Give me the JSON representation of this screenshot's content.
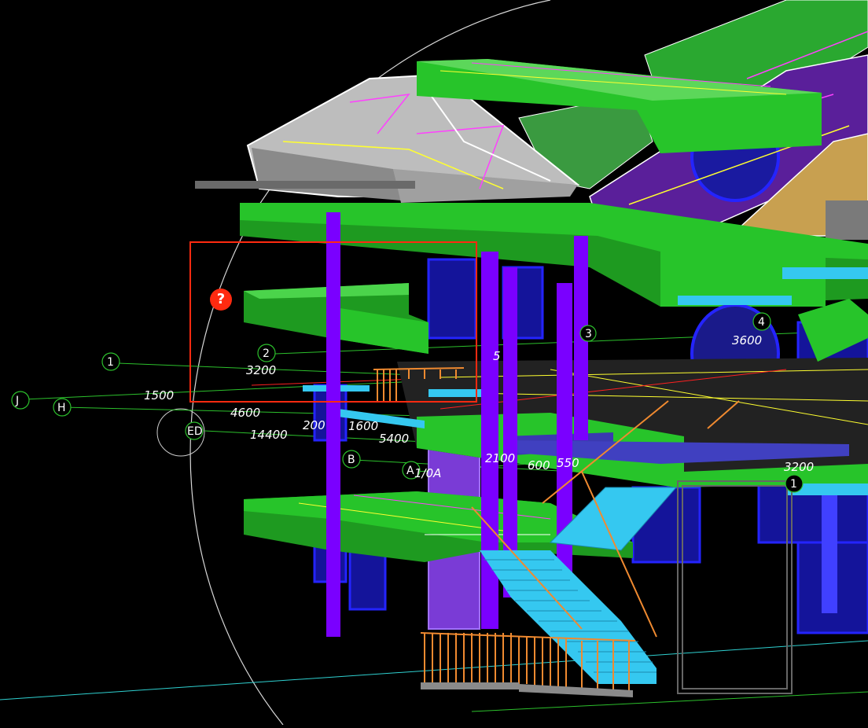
{
  "viewport": {
    "background": "#000000",
    "issue_marker": {
      "glyph": "?",
      "color": "#ff2a10",
      "icon": "question-icon"
    },
    "selection_color": "#ff2a10"
  },
  "grid_labels": {
    "g1": "1",
    "g2": "2",
    "g4": "4",
    "gB": "B",
    "gA": "A",
    "gJ": "J",
    "gH": "H",
    "gED": "ED",
    "g1_right": "1",
    "g5": "5",
    "g3": "3"
  },
  "dimensions": {
    "d3200_left": "3200",
    "d1500": "1500",
    "d4600": "4600",
    "d14400": "14400",
    "d200": "200",
    "d1600": "1600",
    "d5400": "5400",
    "d1_0A": "1/0A",
    "d2100": "2100",
    "d600": "600",
    "d550": "550",
    "d3600": "3600",
    "d3200_right": "3200",
    "d5": "5"
  },
  "colors": {
    "slab_green": "#27c42a",
    "slab_dark": "#1e9a20",
    "column_purple": "#7a00ff",
    "window_blue": "#1a1aff",
    "stair_cyan": "#35c8f0",
    "rail_orange": "#f08a30",
    "roof_grey": "#bdbdbd",
    "roof_purple": "#5a1f9a",
    "beam_magenta": "#ff40ff",
    "beam_yellow": "#ffff30"
  }
}
